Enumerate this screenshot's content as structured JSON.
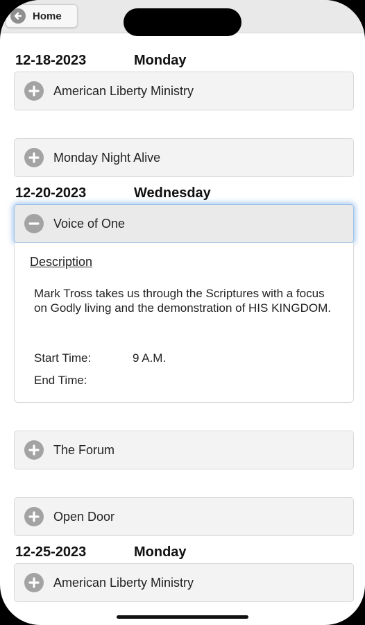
{
  "header": {
    "home_label": "Home"
  },
  "schedule": [
    {
      "date": "12-18-2023",
      "day": "Monday"
    },
    {
      "date": "12-20-2023",
      "day": "Wednesday"
    },
    {
      "date": "12-25-2023",
      "day": "Monday"
    }
  ],
  "items": [
    {
      "title": "American Liberty Ministry",
      "state": "collapsed"
    },
    {
      "title": "Monday Night Alive",
      "state": "collapsed"
    },
    {
      "title": "Voice of One",
      "state": "expanded"
    },
    {
      "title": "The Forum",
      "state": "collapsed"
    },
    {
      "title": "Open Door",
      "state": "collapsed"
    },
    {
      "title": "American Liberty Ministry",
      "state": "collapsed"
    }
  ],
  "details": {
    "heading": "Description",
    "body": "Mark Tross takes us through the Scriptures with a focus on Godly living and the demonstration of HIS KINGDOM.",
    "start_label": "Start Time:",
    "start_value": "9 A.M.",
    "end_label": "End Time:",
    "end_value": ""
  },
  "colors": {
    "active_glow": "#5a96dc",
    "icon_gray": "#a3a3a3",
    "bar_bg": "#e9e9e9"
  },
  "icons": {
    "expand": "plus-circle-icon",
    "collapse": "minus-circle-icon",
    "back": "arrow-left-circle-icon"
  }
}
